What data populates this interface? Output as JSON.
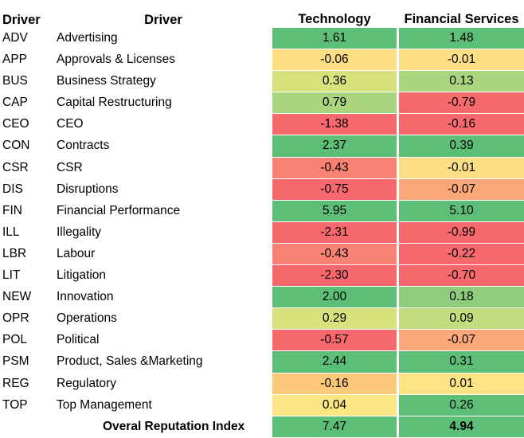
{
  "header": {
    "code_label": "Driver",
    "name_label": "Driver",
    "tech_label": "Technology",
    "fin_label": "Financial Services"
  },
  "palette": {
    "green": "#5DBE78",
    "light_green": "#AAD47E",
    "yellow_green": "#D6E27C",
    "yellow": "#FCDE84",
    "orange": "#FCC87A",
    "salmon": "#FA8274",
    "red": "#F8696E",
    "white": "#FFFFFF"
  },
  "chart_data": {
    "type": "heatmap",
    "title": "",
    "xlabel": "",
    "ylabel": "",
    "columns": [
      "Driver",
      "Driver",
      "Technology",
      "Financial Services"
    ],
    "categories": [
      "Advertising",
      "Approvals & Licenses",
      "Business Strategy",
      "Capital Restructuring",
      "CEO",
      "Contracts",
      "CSR",
      "Disruptions",
      "Financial Performance",
      "Illegality",
      "Labour",
      "Litigation",
      "Innovation",
      "Operations",
      "Political",
      "Product, Sales &Marketing",
      "Regulatory",
      "Top Management",
      "Overal Reputation Index"
    ],
    "series": [
      {
        "name": "Technology",
        "values": [
          1.61,
          -0.06,
          0.36,
          0.79,
          -1.38,
          2.37,
          -0.43,
          -0.75,
          5.95,
          -2.31,
          -0.43,
          -2.3,
          2.0,
          0.29,
          -0.57,
          2.44,
          -0.16,
          0.04,
          7.47
        ]
      },
      {
        "name": "Financial Services",
        "values": [
          1.48,
          -0.01,
          0.13,
          -0.79,
          -0.16,
          0.39,
          -0.01,
          -0.07,
          5.1,
          -0.99,
          -0.22,
          -0.7,
          0.18,
          0.09,
          -0.07,
          0.31,
          0.01,
          0.26,
          4.94
        ]
      }
    ],
    "legend_position": "none",
    "grid": false
  },
  "rows": [
    {
      "code": "ADV",
      "name": "Advertising",
      "tech": "1.61",
      "tech_color": "#5DBE78",
      "fin": "1.48",
      "fin_color": "#5DBE78"
    },
    {
      "code": "APP",
      "name": "Approvals & Licenses",
      "tech": "-0.06",
      "tech_color": "#FCDE84",
      "fin": "-0.01",
      "fin_color": "#FCDE84"
    },
    {
      "code": "BUS",
      "name": "Business Strategy",
      "tech": "0.36",
      "tech_color": "#D6E27C",
      "fin": "0.13",
      "fin_color": "#AAD47E"
    },
    {
      "code": "CAP",
      "name": "Capital Restructuring",
      "tech": "0.79",
      "tech_color": "#AAD47E",
      "fin": "-0.79",
      "fin_color": "#F8696E"
    },
    {
      "code": "CEO",
      "name": "CEO",
      "tech": "-1.38",
      "tech_color": "#F8696E",
      "fin": "-0.16",
      "fin_color": "#F8696E"
    },
    {
      "code": "CON",
      "name": "Contracts",
      "tech": "2.37",
      "tech_color": "#5DBE78",
      "fin": "0.39",
      "fin_color": "#5DBE78"
    },
    {
      "code": "CSR",
      "name": "CSR",
      "tech": "-0.43",
      "tech_color": "#FA8274",
      "fin": "-0.01",
      "fin_color": "#FCDE84"
    },
    {
      "code": "DIS",
      "name": "Disruptions",
      "tech": "-0.75",
      "tech_color": "#F8696E",
      "fin": "-0.07",
      "fin_color": "#FCA779"
    },
    {
      "code": "FIN",
      "name": "Financial Performance",
      "tech": "5.95",
      "tech_color": "#5DBE78",
      "fin": "5.10",
      "fin_color": "#5DBE78"
    },
    {
      "code": "ILL",
      "name": "Illegality",
      "tech": "-2.31",
      "tech_color": "#F8696E",
      "fin": "-0.99",
      "fin_color": "#F8696E"
    },
    {
      "code": "LBR",
      "name": "Labour",
      "tech": "-0.43",
      "tech_color": "#FA8274",
      "fin": "-0.22",
      "fin_color": "#F8696E"
    },
    {
      "code": "LIT",
      "name": "Litigation",
      "tech": "-2.30",
      "tech_color": "#F8696E",
      "fin": "-0.70",
      "fin_color": "#F8696E"
    },
    {
      "code": "NEW",
      "name": "Innovation",
      "tech": "2.00",
      "tech_color": "#5DBE78",
      "fin": "0.18",
      "fin_color": "#8FCC7E"
    },
    {
      "code": "OPR",
      "name": "Operations",
      "tech": "0.29",
      "tech_color": "#D6E27C",
      "fin": "0.09",
      "fin_color": "#C3DC7D"
    },
    {
      "code": "POL",
      "name": "Political",
      "tech": "-0.57",
      "tech_color": "#F8696E",
      "fin": "-0.07",
      "fin_color": "#FCA779"
    },
    {
      "code": "PSM",
      "name": "Product, Sales &Marketing",
      "tech": "2.44",
      "tech_color": "#5DBE78",
      "fin": "0.31",
      "fin_color": "#5DBE78"
    },
    {
      "code": "REG",
      "name": "Regulatory",
      "tech": "-0.16",
      "tech_color": "#FCC87A",
      "fin": "0.01",
      "fin_color": "#FCE384"
    },
    {
      "code": "TOP",
      "name": "Top Management",
      "tech": "0.04",
      "tech_color": "#FAE784",
      "fin": "0.26",
      "fin_color": "#5DBE78"
    },
    {
      "code": "",
      "name": "Overal Reputation Index",
      "tech": "7.47",
      "tech_color": "#5DBE78",
      "fin": "4.94",
      "fin_color": "#5DBE78",
      "total": true
    }
  ]
}
